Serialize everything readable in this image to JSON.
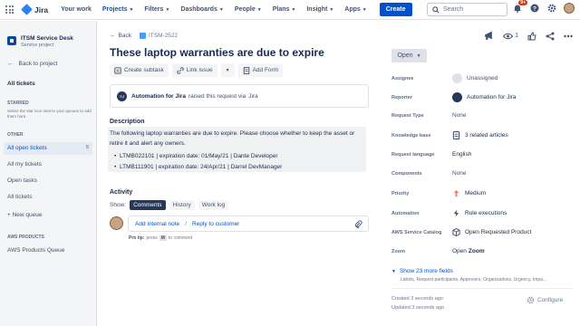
{
  "topnav": {
    "logo_text": "Jira",
    "items": [
      {
        "label": "Your work",
        "dropdown": false,
        "active": false
      },
      {
        "label": "Projects",
        "dropdown": true,
        "active": true
      },
      {
        "label": "Filters",
        "dropdown": true,
        "active": false
      },
      {
        "label": "Dashboards",
        "dropdown": true,
        "active": false
      },
      {
        "label": "People",
        "dropdown": true,
        "active": false
      },
      {
        "label": "Plans",
        "dropdown": true,
        "active": false
      },
      {
        "label": "Insight",
        "dropdown": true,
        "active": false
      },
      {
        "label": "Apps",
        "dropdown": true,
        "active": false
      }
    ],
    "create_label": "Create",
    "search_placeholder": "Search",
    "notification_count": "9+"
  },
  "sidebar": {
    "project_name": "ITSM Service Desk",
    "project_type": "Service project",
    "back_label": "Back to project",
    "all_tickets_title": "All tickets",
    "starred_heading": "STARRED",
    "starred_note": "Select the star icon next to your queues to add them here.",
    "other_heading": "OTHER",
    "queues": [
      {
        "label": "All open tickets",
        "count": "5"
      },
      {
        "label": "All my tickets",
        "count": ""
      },
      {
        "label": "Open tasks",
        "count": ""
      },
      {
        "label": "All tickets",
        "count": ""
      }
    ],
    "new_queue_label": "+ New queue",
    "aws_heading": "AWS PRODUCTS",
    "aws_queue_label": "AWS Products Queue"
  },
  "issue": {
    "back_label": "Back",
    "key": "ITSM-2522",
    "title": "These laptop warranties are due to expire",
    "toolbar": {
      "subtask_label": "Create subtask",
      "link_label": "Link issue",
      "form_label": "Add Form"
    },
    "raised": {
      "avatar_initials": "AJ",
      "actor": "Automation for Jira",
      "text": "raised this request via",
      "channel": "Jira"
    },
    "description_label": "Description",
    "description_text": "The following laptop warranties are due to expire. Please choose whether to keep the asset or retire it and alert any owners.",
    "description_items": [
      "LTMB022101 | expiration date: 01/May/21 | Dante Developer",
      "LTMB111901 | expiration date: 24/Apr/21 | Darrel DevManager"
    ],
    "activity_label": "Activity",
    "show_label": "Show:",
    "activity_tabs": [
      "Comments",
      "History",
      "Work log"
    ],
    "internal_note_label": "Add internal note",
    "separator": "/",
    "reply_label": "Reply to customer",
    "protip_prefix": "Pro tip:",
    "protip_press": "press",
    "protip_key": "M",
    "protip_suffix": "to comment"
  },
  "panel": {
    "watch_count": "1",
    "status_label": "Open",
    "fields": [
      {
        "label": "Assignee",
        "value": "Unassigned",
        "icon": "unassigned-avatar-icon"
      },
      {
        "label": "Reporter",
        "value": "Automation for Jira",
        "icon": "automation-avatar-icon"
      },
      {
        "label": "Request Type",
        "value": "None",
        "icon": ""
      },
      {
        "label": "Knowledge base",
        "value": "3 related articles",
        "icon": "article-icon"
      },
      {
        "label": "Request language",
        "value": "English",
        "icon": ""
      },
      {
        "label": "Components",
        "value": "None",
        "icon": ""
      },
      {
        "label": "Priority",
        "value": "Medium",
        "icon": "priority-medium-icon"
      },
      {
        "label": "Automation",
        "value": "Rule executions",
        "icon": "lightning-icon"
      },
      {
        "label": "AWS Service Catalog",
        "value": "Open Requested Product",
        "icon": "cube-icon"
      },
      {
        "label": "Zoom",
        "value": "Open Zoom",
        "icon": ""
      }
    ],
    "zoom_prefix": "Open",
    "zoom_bold": "Zoom",
    "show_more_label": "Show 23 more fields",
    "more_fields_list": "Labels, Request participants, Approvers, Organizations, Urgency, Impa...",
    "created": "Created 3 seconds ago",
    "updated": "Updated 3 seconds ago",
    "configure_label": "Configure"
  },
  "colors": {
    "brand": "#0052cc",
    "priority_medium": "#ff7452",
    "notification": "#de350b"
  }
}
